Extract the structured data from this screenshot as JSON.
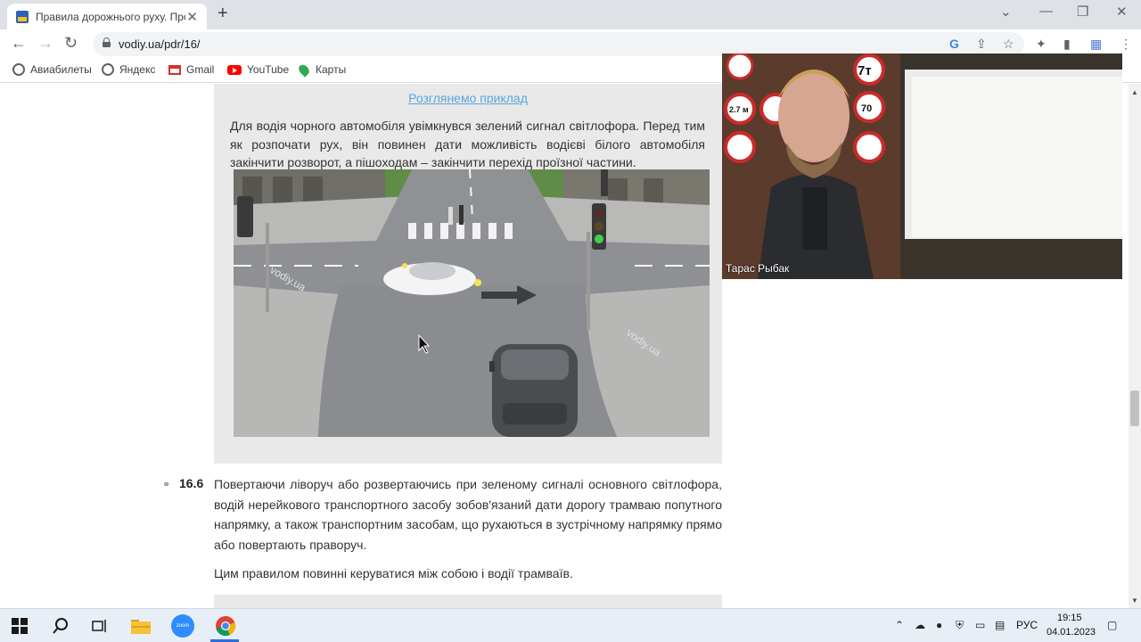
{
  "browser": {
    "tab_title": "Правила дорожнього руху. Про",
    "tab_close": "✕",
    "new_tab": "+",
    "window_controls": [
      "⌄",
      "—",
      "❐",
      "✕"
    ],
    "nav": {
      "back": "←",
      "forward": "→",
      "reload": "↻"
    },
    "url": "vodiy.ua/pdr/16/",
    "toolbar_icons": [
      "G",
      "⇪",
      "☆",
      "✦",
      "▮",
      "▦",
      "⋮"
    ],
    "bookmarks": [
      {
        "label": "Авиабилеты",
        "icon": "globe-icon",
        "color": "#5f6368"
      },
      {
        "label": "Яндекс",
        "icon": "yandex-icon",
        "color": "#5f6368"
      },
      {
        "label": "Gmail",
        "icon": "gmail-icon",
        "color": "#d93025"
      },
      {
        "label": "YouTube",
        "icon": "youtube-icon",
        "color": "#ff0000"
      },
      {
        "label": "Карты",
        "icon": "maps-icon",
        "color": "#34a853"
      }
    ]
  },
  "page": {
    "example_link": "Розглянемо приклад",
    "example_text": "Для водія чорного автомобіля увімкнувся зелений сигнал світлофора. Перед тим як розпочати рух, він повинен дати можливість водієві білого автомобіля закінчити розворот, а пішоходам – закінчити перехід проїзної частини.",
    "watermark": "vodiy.ua",
    "rule_icon": "⚭",
    "rule_number": "16.6",
    "rule_text": "Повертаючи ліворуч або розвертаючись при зеленому сигналі основного світлофора, водій нерейкового транспортного засобу зобов'язаний дати дорогу трамваю попутного напрямку, а також транспортним засобам, що рухаються в зустрічному напрямку прямо або повертають праворуч.",
    "rule_note": "Цим правилом повинні керуватися між собою і водії трамваїв."
  },
  "video": {
    "participant_name": "Тарас Рыбак",
    "sign_labels": [
      "7т",
      "2.7 м",
      "70"
    ]
  },
  "taskbar": {
    "apps": [
      "windows-start-icon",
      "search-icon",
      "task-view-icon",
      "file-explorer-icon",
      "zoom-icon",
      "chrome-icon"
    ],
    "zoom_label": "zoom",
    "language": "РУС",
    "time": "19:15",
    "date": "04.01.2023"
  },
  "colors": {
    "link": "#5aa6dd",
    "example_bg": "#e9e9e9",
    "tabstrip": "#dee1e6",
    "traffic_green": "#3fd24a"
  }
}
